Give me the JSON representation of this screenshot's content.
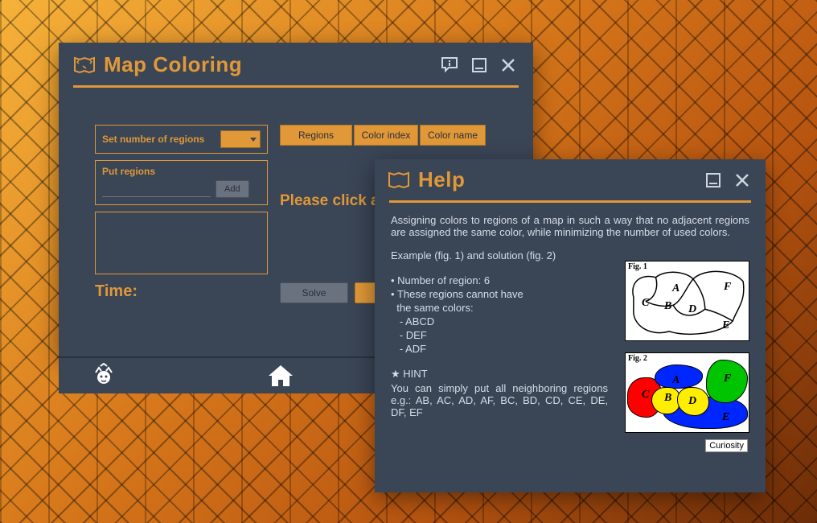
{
  "main": {
    "title": "Map Coloring",
    "set_regions_label": "Set number of regions",
    "put_regions_label": "Put regions",
    "add_button": "Add",
    "time_label": "Time:",
    "tabs": {
      "regions": "Regions",
      "color_index": "Color index",
      "color_name": "Color name"
    },
    "prompt": "Please click a",
    "solve_button": "Solve"
  },
  "help": {
    "title": "Help",
    "intro": "Assigning colors to regions of a map in such a way that no adjacent regions are assigned the same color, while minimizing the number of used colors.",
    "example_line": "Example (fig. 1) and solution (fig. 2)",
    "bullet1": "• Number of region: 6",
    "bullet2": "• These regions cannot have",
    "bullet2b": "  the same colors:",
    "group1": "   - ABCD",
    "group2": "   - DEF",
    "group3": "   - ADF",
    "hint_label": "★ HINT",
    "hint_text": "You can simply put all neighboring regions e.g.: AB, AC, AD, AF, BC, BD, CD, CE, DE, DF, EF",
    "fig1_label": "Fig. 1",
    "fig2_label": "Fig. 2",
    "curiosity": "Curiosity",
    "regions": {
      "a": "A",
      "b": "B",
      "c": "C",
      "d": "D",
      "e": "E",
      "f": "F"
    }
  },
  "colors": {
    "accent": "#e09838",
    "panel": "#3a4556",
    "red": "#ff0000",
    "blue": "#0026ff",
    "green": "#00c400",
    "yellow": "#ffee00"
  }
}
